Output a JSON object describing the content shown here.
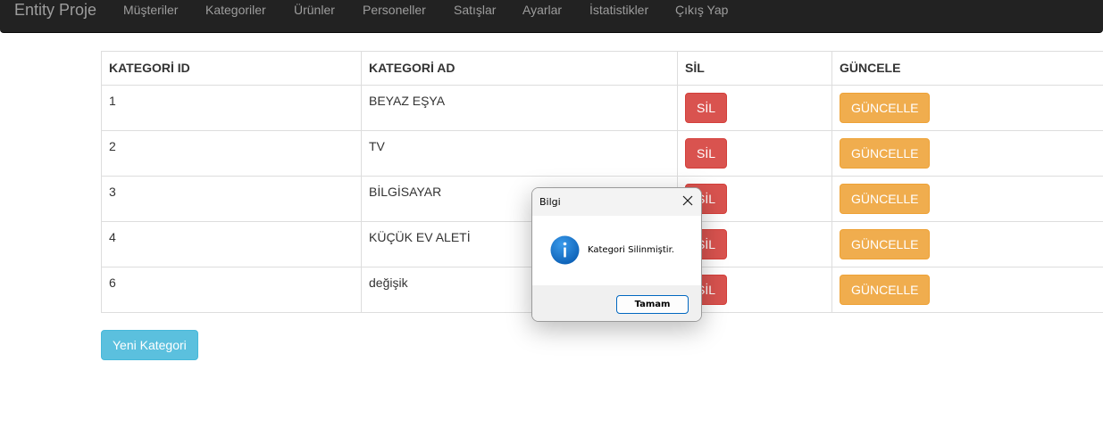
{
  "navbar": {
    "brand": "Entity Proje",
    "items": [
      "Müşteriler",
      "Kategoriler",
      "Ürünler",
      "Personeller",
      "Satışlar",
      "Ayarlar",
      "İstatistikler",
      "Çıkış Yap"
    ]
  },
  "table": {
    "headers": [
      "KATEGORİ ID",
      "KATEGORİ AD",
      "SİL",
      "GÜNCELE"
    ],
    "rows": [
      {
        "id": "1",
        "name": "BEYAZ EŞYA",
        "delete": "SİL",
        "update": "GÜNCELLE"
      },
      {
        "id": "2",
        "name": "TV",
        "delete": "SİL",
        "update": "GÜNCELLE"
      },
      {
        "id": "3",
        "name": "BİLGİSAYAR",
        "delete": "SİL",
        "update": "GÜNCELLE"
      },
      {
        "id": "4",
        "name": "KÜÇÜK EV ALETİ",
        "delete": "SİL",
        "update": "GÜNCELLE"
      },
      {
        "id": "6",
        "name": "değişik",
        "delete": "SİL",
        "update": "GÜNCELLE"
      }
    ]
  },
  "new_button": "Yeni Kategori",
  "dialog": {
    "title": "Bilgi",
    "message": "Kategori Silinmiştir.",
    "ok": "Tamam",
    "icon": "info-icon"
  },
  "colors": {
    "navbar_bg": "#222222",
    "danger": "#d9534f",
    "warning": "#f0ad4e",
    "info": "#5bc0de",
    "dialog_icon": "#1a73c8"
  }
}
